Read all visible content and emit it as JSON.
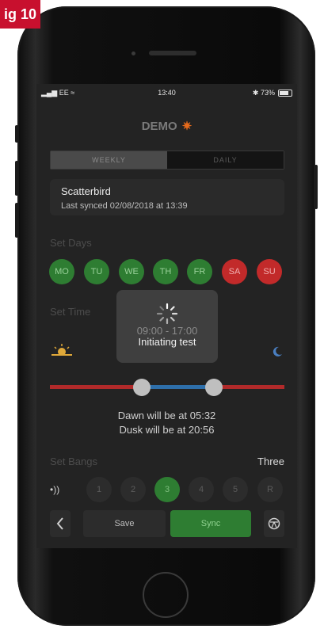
{
  "figure_label": "ig 10",
  "status_bar": {
    "carrier": "EE",
    "time": "13:40",
    "battery": "73%"
  },
  "header": {
    "title": "DEMO"
  },
  "view_toggle": {
    "weekly": "WEEKLY",
    "daily": "DAILY",
    "selected": "weekly"
  },
  "device": {
    "name": "Scatterbird",
    "last_synced": "Last synced 02/08/2018 at 13:39"
  },
  "set_days": {
    "label": "Set Days",
    "days": [
      {
        "label": "MO",
        "active": true
      },
      {
        "label": "TU",
        "active": true
      },
      {
        "label": "WE",
        "active": true
      },
      {
        "label": "TH",
        "active": true
      },
      {
        "label": "FR",
        "active": true
      },
      {
        "label": "SA",
        "active": false
      },
      {
        "label": "SU",
        "active": false
      }
    ]
  },
  "set_time": {
    "label": "Set Time",
    "range_text": "09:00 - 17:00"
  },
  "sun_times": {
    "dawn": "Dawn will be at 05:32",
    "dusk": "Dusk will be at 20:56"
  },
  "set_bangs": {
    "label": "Set Bangs",
    "value": "Three",
    "options": [
      "1",
      "2",
      "3",
      "4",
      "5",
      "R"
    ],
    "selected": "3"
  },
  "actions": {
    "save": "Save",
    "sync": "Sync"
  },
  "overlay": {
    "message": "Initiating test"
  },
  "colors": {
    "active_green": "#2e7d32",
    "inactive_red": "#c22a2a",
    "brand_orange": "#e56a1c",
    "slider_blue": "#2e6faa"
  }
}
